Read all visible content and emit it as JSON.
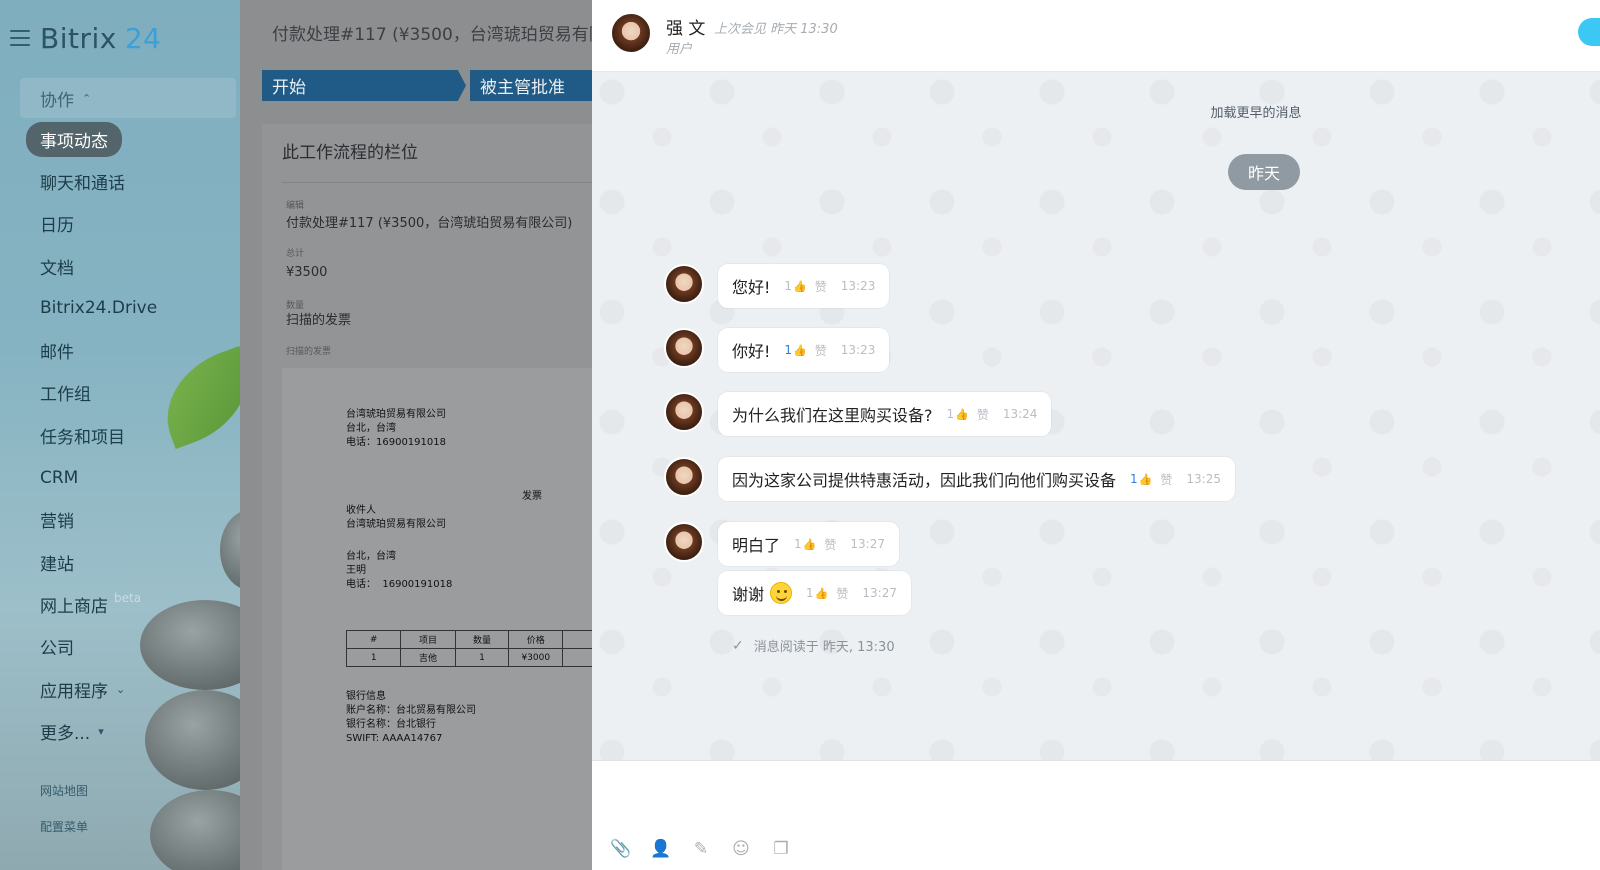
{
  "sidebar": {
    "logo": {
      "text": "Bitrix",
      "num": "24"
    },
    "group_label": "协作",
    "items": [
      {
        "label": "事项动态"
      },
      {
        "label": "聊天和通话"
      },
      {
        "label": "日历"
      },
      {
        "label": "文档"
      },
      {
        "label": "Bitrix24.Drive"
      },
      {
        "label": "邮件"
      },
      {
        "label": "工作组"
      },
      {
        "label": "任务和项目"
      },
      {
        "label": "CRM"
      },
      {
        "label": "营销"
      },
      {
        "label": "建站"
      },
      {
        "label": "网上商店",
        "badge": "beta"
      },
      {
        "label": "公司"
      },
      {
        "label": "应用程序"
      },
      {
        "label": "更多..."
      }
    ],
    "footer": {
      "sitemap": "网站地图",
      "config": "配置菜单"
    }
  },
  "workflow": {
    "title": "付款处理#117 (¥3500，台湾琥珀贸易有限",
    "stages": [
      "开始",
      "被主管批准"
    ],
    "card_title": "此工作流程的栏位",
    "fields": [
      {
        "label": "编辑",
        "value": "付款处理#117 (¥3500，台湾琥珀贸易有限公司)"
      },
      {
        "label": "总计",
        "value": "¥3500"
      },
      {
        "label": "数量",
        "value": "扫描的发票"
      }
    ],
    "attachment_label": "扫描的发票",
    "invoice": {
      "company": "台湾琥珀贸易有限公司\n台北，台湾\n电话：16900191018",
      "title": "发票",
      "recipient": "收件人\n台湾琥珀贸易有限公司",
      "address": "台北，台湾\n王明\n电话：  16900191018",
      "table_headers": [
        "#",
        "项目",
        "数量",
        "价格"
      ],
      "table_row": [
        "1",
        "吉他",
        "1",
        "¥3000"
      ],
      "bank": "银行信息\n账户名称：台北贸易有限公司\n银行名称：台北银行\nSWIFT: AAAA14767"
    }
  },
  "chat": {
    "header": {
      "name": "强 文",
      "last_seen": "上次会见 昨天 13:30",
      "role": "用户"
    },
    "load_earlier": "加载更早的消息",
    "date_badge": "昨天",
    "like_word": "赞",
    "messages": [
      {
        "text": "您好!",
        "likes": "1",
        "liked": false,
        "time": "13:23"
      },
      {
        "text": "你好!",
        "likes": "1",
        "liked": true,
        "time": "13:23"
      },
      {
        "text": "为什么我们在这里购买设备?",
        "likes": "1",
        "liked": false,
        "time": "13:24"
      },
      {
        "text": "因为这家公司提供特惠活动，因此我们向他们购买设备",
        "likes": "1",
        "liked": true,
        "time": "13:25"
      },
      {
        "text": "明白了",
        "likes": "1",
        "liked": false,
        "time": "13:27"
      },
      {
        "text": "谢谢",
        "likes": "1",
        "liked": false,
        "time": "13:27",
        "emoji": "smiley"
      }
    ],
    "read_receipt": "消息阅读于 昨天, 13:30",
    "toolbar_icons": [
      "paperclip-icon",
      "user-icon",
      "edit-icon",
      "smiley-icon",
      "screens-icon"
    ]
  },
  "colors": {
    "accent": "#3bc8f5",
    "stage": "#1f5b86",
    "like": "#2f7fd8",
    "date_badge": "#909aa3"
  }
}
